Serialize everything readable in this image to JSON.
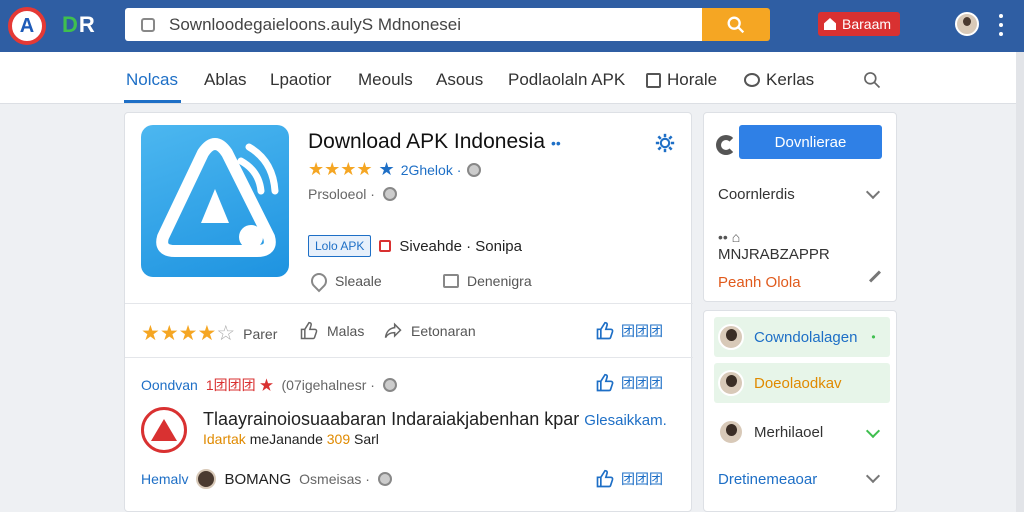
{
  "header": {
    "logo_letter": "A",
    "logo_text_d": "D",
    "logo_text_r": "R",
    "search_value": "Sownloodegaieloons.aulyS Mdnonesei",
    "brand_button": "Baraam"
  },
  "nav": {
    "items": [
      "Nolcas",
      "Ablas",
      "Lpaotior",
      "Meouls",
      "Asous",
      "Podlaolaln APK",
      "Horale",
      "Kerlas"
    ]
  },
  "app": {
    "title": "Download APK Indonesia",
    "title_dots": "••",
    "rating_stars": "★★★★",
    "rating_text": "2Ghelok ·",
    "sub_text": "Prsoloeol ·",
    "apk_badge": "Lolo APK",
    "tag_text": "Siveahde · Sonipa",
    "action_1": "Sleaale",
    "action_2": "Denenigra"
  },
  "rating_row": {
    "stars_filled": "★★★★",
    "star_outline": "☆",
    "label_1": "Parer",
    "label_2": "Malas",
    "label_3": "Eetonaran",
    "thumb_text": "团团团"
  },
  "reviews": [
    {
      "prefix": "Oondvan",
      "highlight": "1团团团 ★",
      "meta": "(07igehalnesr ·",
      "thumb_text": "团团团"
    },
    {
      "prefix": "Hemalv",
      "highlight": "BOMANG",
      "meta": "Osmeisas ·",
      "thumb_text": "团团团"
    }
  ],
  "publisher": {
    "line1": "Tlaayrainoiosuaabaran Indaraiakjabenhan kpar",
    "line1_suffix": "Glesaikkam.",
    "line2_a": "Idartak",
    "line2_b": "meJanande",
    "line2_c": "309",
    "line2_d": "Sarl"
  },
  "side": {
    "download_button": "Dovnlierae",
    "row1": "Coornlerdis",
    "row2_icons": "•• ⌂",
    "row2": "MNJRABZAPPR",
    "row3": "Peanh Olola"
  },
  "list": [
    {
      "label": "Cowndolalagen",
      "dot": "•",
      "bg": "#e7f5e9",
      "color": "#1e6fc6"
    },
    {
      "label": "Doeolaodkav",
      "dot": "",
      "bg": "#e7f5e9",
      "color": "#e08a00"
    },
    {
      "label": "Merhilaoel",
      "dot": "",
      "bg": "#ffffff",
      "color": "#333333"
    },
    {
      "label": "Dretinemeaoar",
      "dot": "",
      "bg": "#ffffff",
      "color": "#1e6fc6"
    }
  ],
  "colors": {
    "topbar": "#2f5ea3",
    "accent": "#1e6fc6",
    "search_button": "#f5a623",
    "brand_button": "#d93131"
  },
  "icons": [
    "search-icon",
    "gear-icon",
    "thumbs-up-icon",
    "heart-icon",
    "share-icon",
    "chevron-down-icon",
    "pencil-icon",
    "globe-icon"
  ]
}
